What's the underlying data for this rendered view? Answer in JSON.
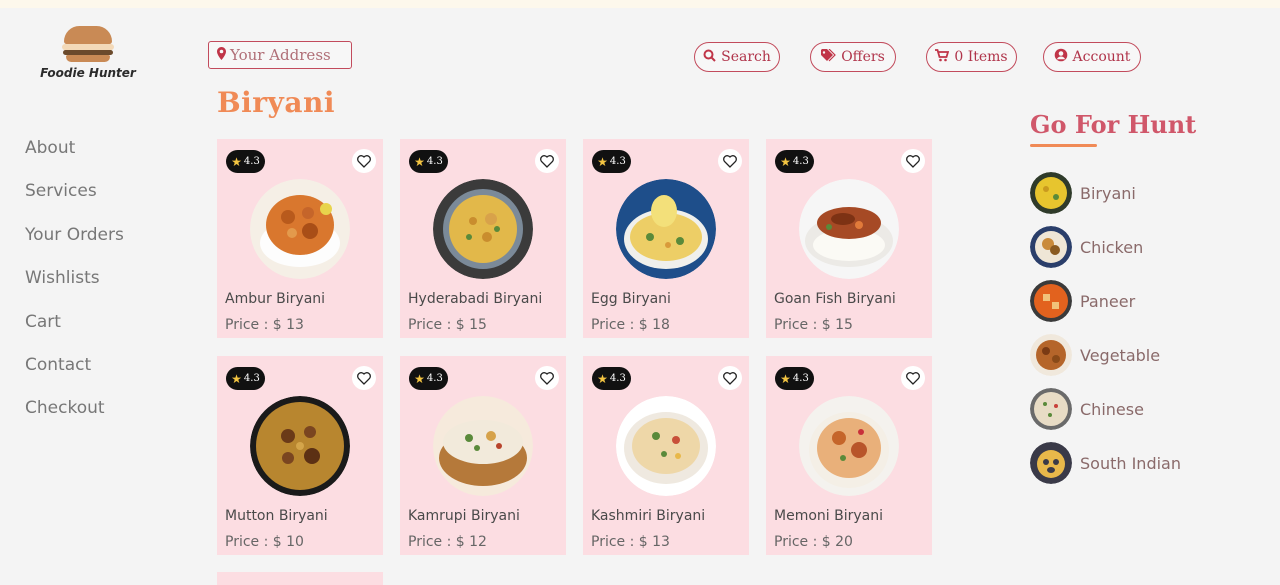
{
  "brand": {
    "name": "Foodie Hunter"
  },
  "sidebar": {
    "items": [
      {
        "label": "About"
      },
      {
        "label": "Services"
      },
      {
        "label": "Your Orders"
      },
      {
        "label": "Wishlists"
      },
      {
        "label": "Cart"
      },
      {
        "label": "Contact"
      },
      {
        "label": "Checkout"
      }
    ]
  },
  "header": {
    "address_placeholder": "Your Address",
    "search_label": "Search",
    "offers_label": "Offers",
    "cart_label": "0 Items",
    "account_label": "Account"
  },
  "page": {
    "title": "Biryani"
  },
  "dishes": [
    {
      "name": "Ambur Biryani",
      "price": "Price : $ 13",
      "rating": "4.3"
    },
    {
      "name": "Hyderabadi Biryani",
      "price": "Price : $ 15",
      "rating": "4.3"
    },
    {
      "name": "Egg Biryani",
      "price": "Price : $ 18",
      "rating": "4.3"
    },
    {
      "name": "Goan Fish Biryani",
      "price": "Price : $ 15",
      "rating": "4.3"
    },
    {
      "name": "Mutton Biryani",
      "price": "Price : $ 10",
      "rating": "4.3"
    },
    {
      "name": "Kamrupi Biryani",
      "price": "Price : $ 12",
      "rating": "4.3"
    },
    {
      "name": "Kashmiri Biryani",
      "price": "Price : $ 13",
      "rating": "4.3"
    },
    {
      "name": "Memoni Biryani",
      "price": "Price : $ 20",
      "rating": "4.3"
    }
  ],
  "categories_panel": {
    "title": "Go For Hunt",
    "items": [
      {
        "label": "Biryani"
      },
      {
        "label": "Chicken"
      },
      {
        "label": "Paneer"
      },
      {
        "label": "Vegetable"
      },
      {
        "label": "Chinese"
      },
      {
        "label": "South Indian"
      }
    ]
  },
  "icons": {
    "pin": "map-pin-icon",
    "search": "search-icon",
    "offers": "tag-icon",
    "cart": "cart-icon",
    "account": "user-icon",
    "heart": "heart-icon",
    "star": "star-icon"
  },
  "colors": {
    "accent": "#c24b5c",
    "title_orange": "#f08a56",
    "card_bg": "#fcdde2",
    "hunt_title": "#d0576a"
  }
}
